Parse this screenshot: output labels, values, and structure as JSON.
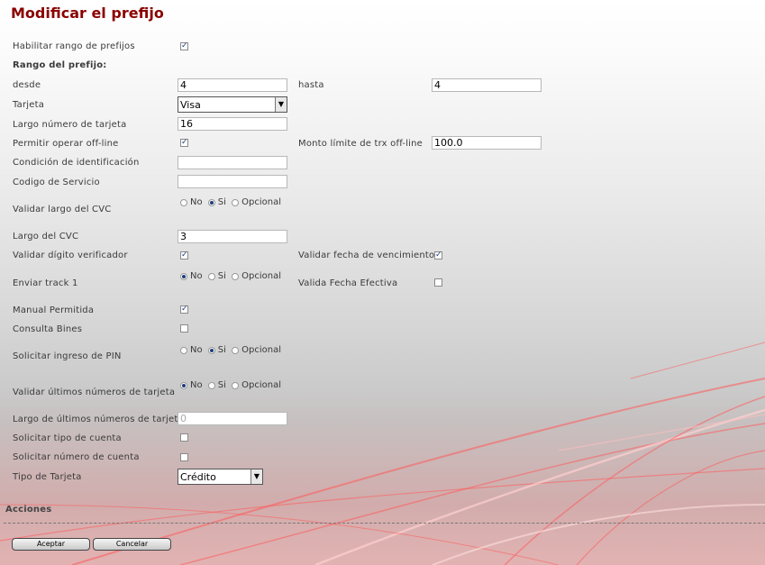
{
  "page": {
    "title": "Modificar el prefijo"
  },
  "form": {
    "habilitar_rango": {
      "label": "Habilitar rango de prefijos",
      "checked": true
    },
    "rango_heading": "Rango del prefijo:",
    "desde": {
      "label": "desde",
      "value": "4"
    },
    "hasta": {
      "label": "hasta",
      "value": "4"
    },
    "tarjeta": {
      "label": "Tarjeta",
      "value": "Visa"
    },
    "largo_numero": {
      "label": "Largo número de tarjeta",
      "value": "16"
    },
    "permitir_offline": {
      "label": "Permitir operar off-line",
      "checked": true
    },
    "monto_limite": {
      "label": "Monto límite de trx off-line",
      "value": "100.0"
    },
    "condicion_identificacion": {
      "label": "Condición de identificación",
      "value": ""
    },
    "codigo_servicio": {
      "label": "Codigo de Servicio",
      "value": ""
    },
    "validar_largo_cvc": {
      "label": "Validar largo del CVC",
      "options": [
        "No",
        "Si",
        "Opcional"
      ],
      "selected": "Si"
    },
    "largo_cvc": {
      "label": "Largo del CVC",
      "value": "3"
    },
    "validar_digito": {
      "label": "Validar dígito verificador",
      "checked": true
    },
    "validar_fecha_vencimiento": {
      "label": "Validar fecha de vencimiento",
      "checked": true
    },
    "enviar_track1": {
      "label": "Enviar track 1",
      "options": [
        "No",
        "Si",
        "Opcional"
      ],
      "selected": "No"
    },
    "valida_fecha_efectiva": {
      "label": "Valida Fecha Efectiva",
      "checked": false
    },
    "manual_permitida": {
      "label": "Manual Permitida",
      "checked": true
    },
    "consulta_bines": {
      "label": "Consulta Bines",
      "checked": false
    },
    "solicitar_pin": {
      "label": "Solicitar ingreso de PIN",
      "options": [
        "No",
        "Si",
        "Opcional"
      ],
      "selected": "Si"
    },
    "validar_ultimos": {
      "label": "Validar últimos números de tarjeta",
      "options": [
        "No",
        "Si",
        "Opcional"
      ],
      "selected": "No"
    },
    "largo_ultimos": {
      "label": "Largo de últimos números de tarjeta",
      "value": "0"
    },
    "solicitar_tipo_cuenta": {
      "label": "Solicitar tipo de cuenta",
      "checked": false
    },
    "solicitar_numero_cuenta": {
      "label": "Solicitar número de cuenta",
      "checked": false
    },
    "tipo_tarjeta": {
      "label": "Tipo de Tarjeta",
      "value": "Crédito"
    }
  },
  "acciones": {
    "heading": "Acciones",
    "aceptar": "Aceptar",
    "cancelar": "Cancelar"
  },
  "icons": {
    "select_arrow": "chevron-down-icon",
    "checkbox_mark": "check-icon"
  },
  "colors": {
    "title": "#8b0000",
    "streaks": "#ff5a5a"
  }
}
